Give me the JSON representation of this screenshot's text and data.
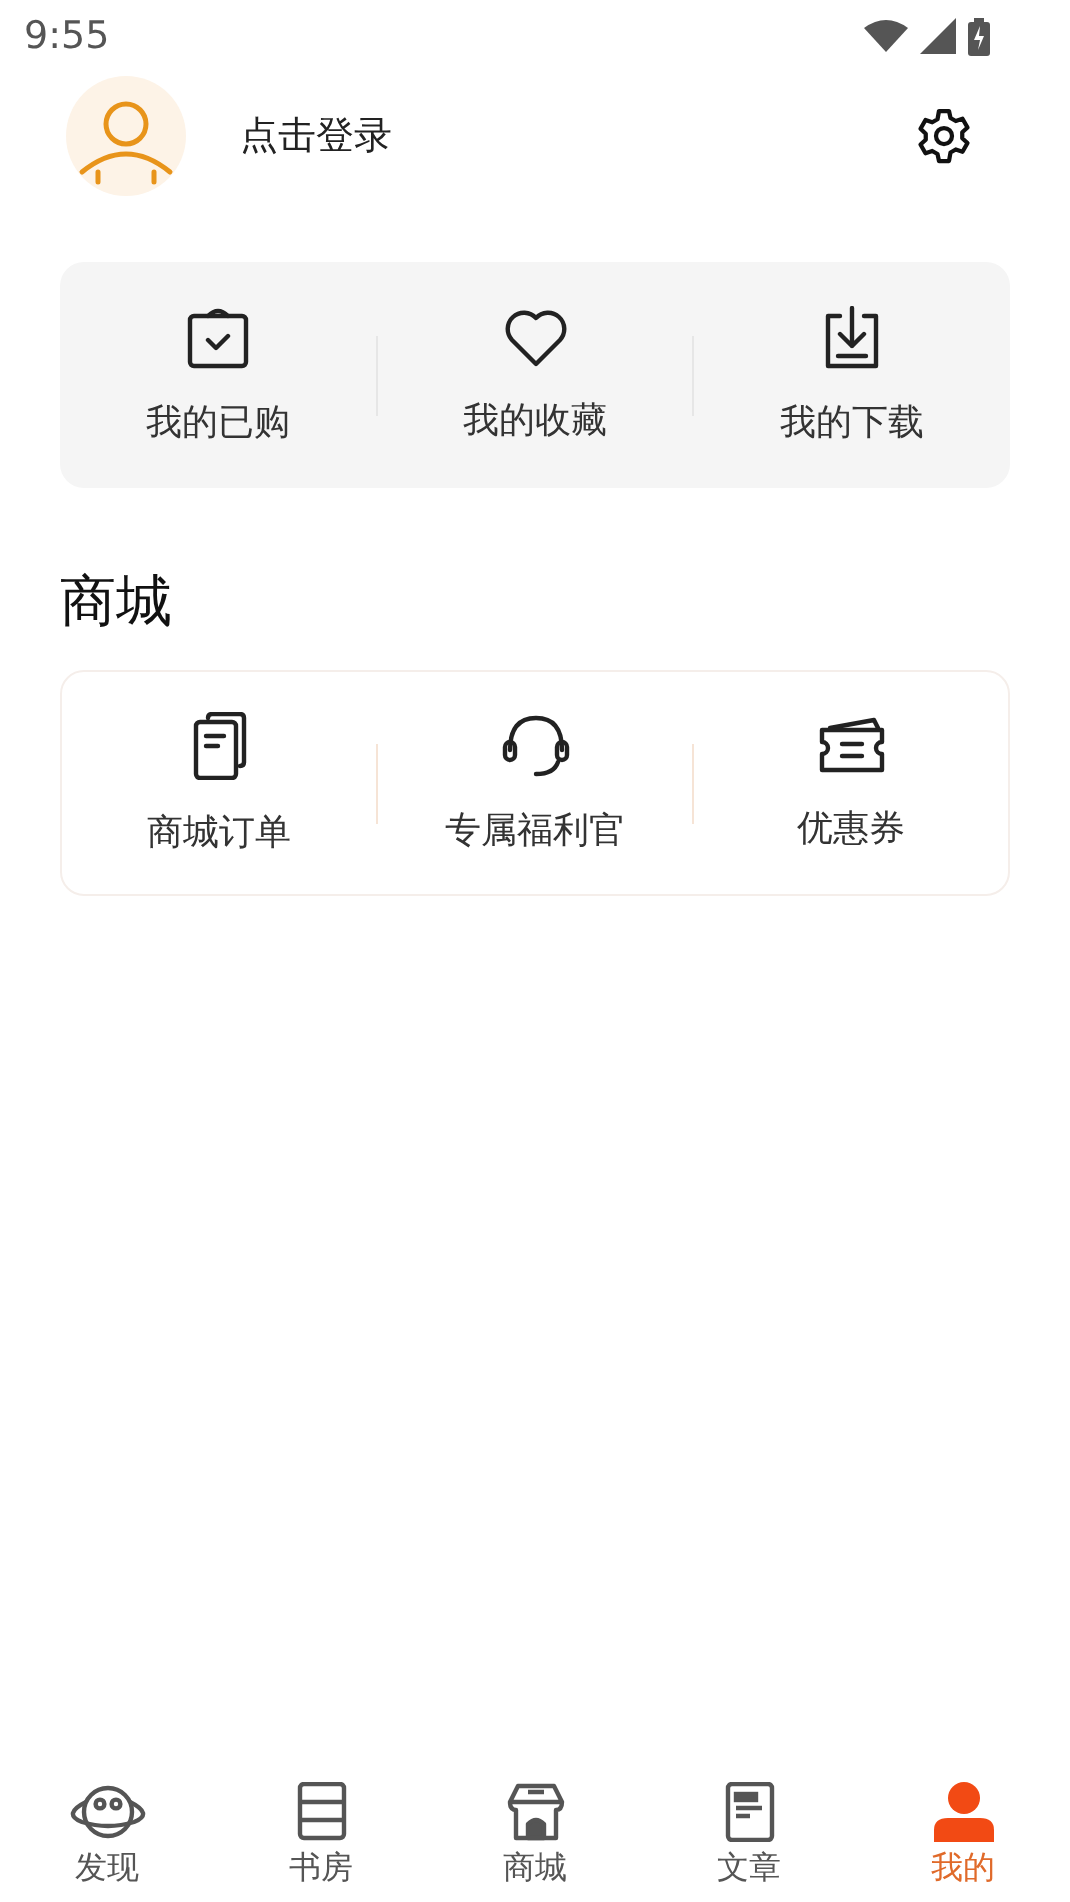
{
  "status_bar": {
    "time": "9:55"
  },
  "profile": {
    "login_label": "点击登录"
  },
  "quick_links": [
    {
      "label": "我的已购"
    },
    {
      "label": "我的收藏"
    },
    {
      "label": "我的下载"
    }
  ],
  "mall": {
    "title": "商城",
    "items": [
      {
        "label": "商城订单"
      },
      {
        "label": "专属福利官"
      },
      {
        "label": "优惠券"
      }
    ]
  },
  "tabs": [
    {
      "label": "发现",
      "selected": false
    },
    {
      "label": "书房",
      "selected": false
    },
    {
      "label": "商城",
      "selected": false
    },
    {
      "label": "文章",
      "selected": false
    },
    {
      "label": "我的",
      "selected": true
    }
  ]
}
